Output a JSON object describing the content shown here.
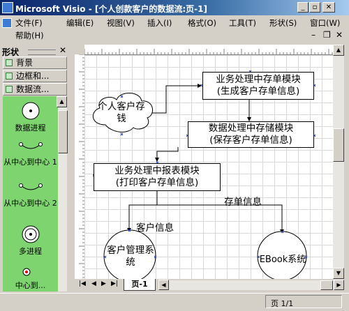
{
  "window": {
    "title": "Microsoft Visio - [个人创款客户的数据流:页-1]"
  },
  "menus": [
    "文件(F)",
    "编辑(E)",
    "视图(V)",
    "插入(I)",
    "格式(O)",
    "工具(T)",
    "形状(S)",
    "窗口(W)",
    "帮助(H)"
  ],
  "shapes_pane": {
    "title": "形状",
    "stencils": [
      "背景",
      "边框和...",
      "数据流..."
    ],
    "items": [
      "数据进程",
      "从中心到中心 1",
      "从中心到中心 2",
      "多进程",
      "中心到..."
    ]
  },
  "diagram": {
    "module_order": "业务处理中存单模块",
    "module_order_sub": "(生成客户存单信息)",
    "customer_cloud": "个人客户存钱",
    "storage": "数据处理中存储模块",
    "storage_sub": "(保存客户存单信息)",
    "report": "业务处理中报表模块",
    "report_sub": "(打印客户存单信息)",
    "label_customer_info": "客户信息",
    "label_deposit_info": "存单信息",
    "customer_mgmt": "客户管理系统",
    "ebook": "EBook系统"
  },
  "page_tab": "页-1",
  "status": {
    "page": "页 1/1"
  },
  "colors": {
    "stencil_bg": "#7ed46e",
    "title_bar": "#0a246a",
    "connection_point": "#1c3ccc"
  }
}
